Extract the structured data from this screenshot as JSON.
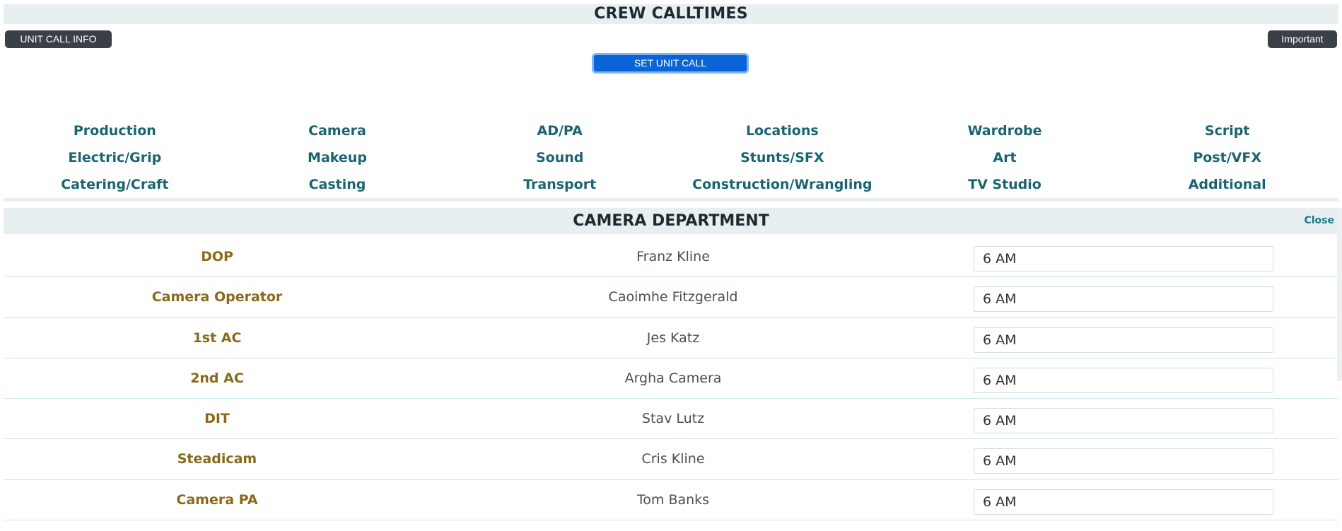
{
  "header": {
    "title": "CREW CALLTIMES"
  },
  "buttons": {
    "unit_call_info": "UNIT CALL INFO",
    "important": "Important",
    "set_unit_call": "SET UNIT CALL"
  },
  "departments": [
    "Production",
    "Camera",
    "AD/PA",
    "Locations",
    "Wardrobe",
    "Script",
    "Electric/Grip",
    "Makeup",
    "Sound",
    "Stunts/SFX",
    "Art",
    "Post/VFX",
    "Catering/Craft",
    "Casting",
    "Transport",
    "Construction/Wrangling",
    "TV Studio",
    "Additional"
  ],
  "section": {
    "title": "CAMERA DEPARTMENT",
    "close_label": "Close"
  },
  "crew": [
    {
      "role": "DOP",
      "name": "Franz Kline",
      "time": "6 AM"
    },
    {
      "role": "Camera Operator",
      "name": "Caoimhe Fitzgerald",
      "time": "6 AM"
    },
    {
      "role": "1st AC",
      "name": "Jes Katz",
      "time": "6 AM"
    },
    {
      "role": "2nd AC",
      "name": "Argha Camera",
      "time": "6 AM"
    },
    {
      "role": "DIT",
      "name": "Stav Lutz",
      "time": "6 AM"
    },
    {
      "role": "Steadicam",
      "name": "Cris Kline",
      "time": "6 AM"
    },
    {
      "role": "Camera PA",
      "name": "Tom Banks",
      "time": "6 AM"
    }
  ],
  "colors": {
    "accent_blue": "#0a64d6",
    "dept_link": "#1a6472",
    "role_text": "#8a6a1a",
    "dark_button": "#3b4046",
    "header_bg": "#e8eff0"
  }
}
